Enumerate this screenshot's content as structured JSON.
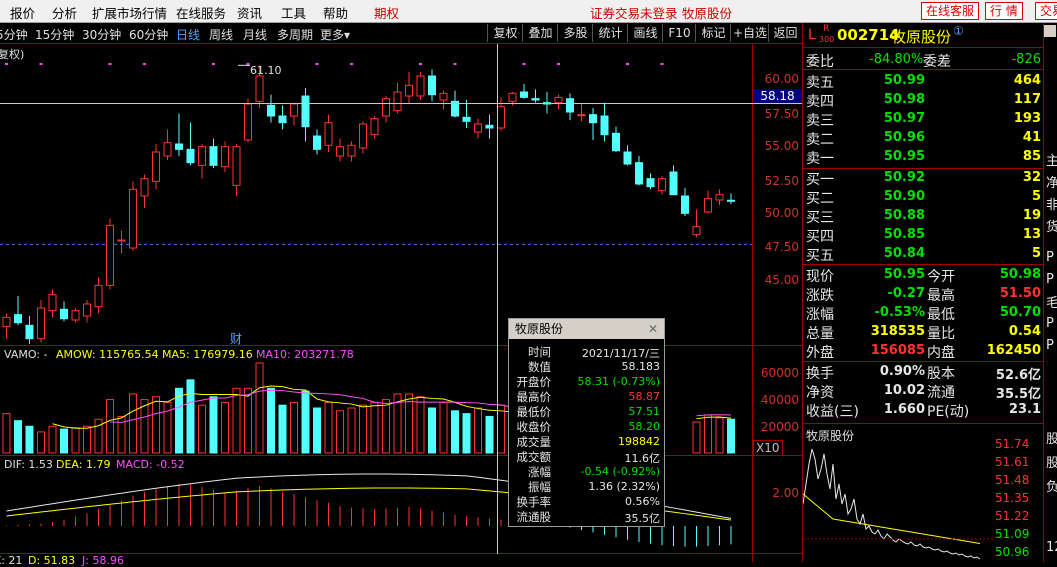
{
  "menu": {
    "items": [
      "报价",
      "分析",
      "扩展市场行情",
      "在线服务",
      "资讯",
      "工具",
      "帮助",
      "期权"
    ],
    "status": "证券交易未登录",
    "stock_name": "牧原股份",
    "btn_service": "在线客服",
    "btn_quote": "行 情",
    "btn_trade": "交易"
  },
  "toolbar": {
    "periods": [
      "5分钟",
      "15分钟",
      "30分钟",
      "60分钟",
      "日线",
      "周线",
      "月线",
      "多周期",
      "更多▾"
    ],
    "active_period": "日线",
    "buttons": [
      "复权",
      "叠加",
      "多股",
      "统计",
      "画线",
      "F10",
      "标记",
      "+自选",
      "返回"
    ]
  },
  "main_chart": {
    "mode_label": "复权)",
    "high_label": "61.10",
    "cross_price": "58.18",
    "event_marker": "财",
    "price_axis": [
      "60.00",
      "57.50",
      "55.00",
      "52.50",
      "50.00",
      "47.50",
      "45.00"
    ],
    "candles": [
      {
        "o": 41.5,
        "h": 42.5,
        "l": 40.6,
        "c": 42.2
      },
      {
        "o": 42.4,
        "h": 43.8,
        "l": 41.6,
        "c": 41.8
      },
      {
        "o": 41.6,
        "h": 42.3,
        "l": 40.2,
        "c": 40.6
      },
      {
        "o": 40.6,
        "h": 43.5,
        "l": 40.3,
        "c": 42.9
      },
      {
        "o": 42.7,
        "h": 44.3,
        "l": 42.2,
        "c": 43.9
      },
      {
        "o": 42.8,
        "h": 43.4,
        "l": 41.9,
        "c": 42.1
      },
      {
        "o": 42.0,
        "h": 42.9,
        "l": 41.8,
        "c": 42.7
      },
      {
        "o": 42.3,
        "h": 43.5,
        "l": 41.8,
        "c": 43.2
      },
      {
        "o": 43.0,
        "h": 45.2,
        "l": 42.5,
        "c": 44.6
      },
      {
        "o": 44.6,
        "h": 49.6,
        "l": 44.3,
        "c": 49.1
      },
      {
        "o": 48.0,
        "h": 48.7,
        "l": 47.0,
        "c": 48.0
      },
      {
        "o": 47.4,
        "h": 52.4,
        "l": 47.2,
        "c": 51.8
      },
      {
        "o": 51.3,
        "h": 52.9,
        "l": 50.4,
        "c": 52.6
      },
      {
        "o": 52.4,
        "h": 55.2,
        "l": 51.8,
        "c": 54.6
      },
      {
        "o": 54.3,
        "h": 56.3,
        "l": 54.0,
        "c": 55.3
      },
      {
        "o": 55.2,
        "h": 57.5,
        "l": 54.3,
        "c": 54.8
      },
      {
        "o": 54.8,
        "h": 56.8,
        "l": 53.6,
        "c": 53.8
      },
      {
        "o": 53.6,
        "h": 55.2,
        "l": 52.6,
        "c": 55.0
      },
      {
        "o": 55.0,
        "h": 55.6,
        "l": 53.4,
        "c": 53.6
      },
      {
        "o": 53.5,
        "h": 55.4,
        "l": 53.1,
        "c": 55.0
      },
      {
        "o": 52.1,
        "h": 55.2,
        "l": 51.3,
        "c": 55.0
      },
      {
        "o": 55.5,
        "h": 58.6,
        "l": 55.3,
        "c": 58.2
      },
      {
        "o": 58.4,
        "h": 61.1,
        "l": 57.9,
        "c": 60.3
      },
      {
        "o": 58.1,
        "h": 58.9,
        "l": 56.8,
        "c": 57.3
      },
      {
        "o": 57.3,
        "h": 58.1,
        "l": 56.3,
        "c": 56.8
      },
      {
        "o": 57.3,
        "h": 58.3,
        "l": 56.6,
        "c": 58.2
      },
      {
        "o": 58.8,
        "h": 59.4,
        "l": 55.4,
        "c": 56.5
      },
      {
        "o": 55.8,
        "h": 56.3,
        "l": 54.4,
        "c": 54.8
      },
      {
        "o": 55.1,
        "h": 57.4,
        "l": 54.6,
        "c": 56.8
      },
      {
        "o": 54.3,
        "h": 55.6,
        "l": 53.9,
        "c": 55.0
      },
      {
        "o": 54.3,
        "h": 55.4,
        "l": 53.9,
        "c": 55.1
      },
      {
        "o": 54.9,
        "h": 56.9,
        "l": 54.5,
        "c": 56.7
      },
      {
        "o": 55.9,
        "h": 57.3,
        "l": 55.6,
        "c": 57.1
      },
      {
        "o": 57.3,
        "h": 58.8,
        "l": 56.8,
        "c": 58.6
      },
      {
        "o": 57.7,
        "h": 59.8,
        "l": 57.5,
        "c": 59.1
      },
      {
        "o": 58.8,
        "h": 60.6,
        "l": 58.2,
        "c": 59.6
      },
      {
        "o": 58.8,
        "h": 60.6,
        "l": 58.5,
        "c": 60.3
      },
      {
        "o": 60.3,
        "h": 60.8,
        "l": 58.4,
        "c": 58.9
      },
      {
        "o": 58.5,
        "h": 59.2,
        "l": 57.8,
        "c": 59.0
      },
      {
        "o": 58.4,
        "h": 59.2,
        "l": 57.2,
        "c": 57.3
      },
      {
        "o": 57.2,
        "h": 58.5,
        "l": 56.4,
        "c": 56.9
      },
      {
        "o": 56.1,
        "h": 57.1,
        "l": 55.6,
        "c": 56.7
      },
      {
        "o": 56.6,
        "h": 57.4,
        "l": 55.6,
        "c": 56.4
      },
      {
        "o": 56.4,
        "h": 58.7,
        "l": 56.2,
        "c": 58.0
      },
      {
        "o": 58.4,
        "h": 59.1,
        "l": 58.1,
        "c": 59.0
      },
      {
        "o": 59.1,
        "h": 59.7,
        "l": 58.6,
        "c": 58.7
      },
      {
        "o": 58.6,
        "h": 59.3,
        "l": 58.3,
        "c": 58.5
      },
      {
        "o": 58.3,
        "h": 59.1,
        "l": 57.5,
        "c": 58.2
      },
      {
        "o": 58.3,
        "h": 58.9,
        "l": 57.8,
        "c": 58.7
      },
      {
        "o": 58.6,
        "h": 59.0,
        "l": 57.0,
        "c": 57.6
      },
      {
        "o": 57.4,
        "h": 58.2,
        "l": 56.9,
        "c": 57.4
      },
      {
        "o": 57.4,
        "h": 57.9,
        "l": 55.5,
        "c": 56.8
      },
      {
        "o": 57.3,
        "h": 58.3,
        "l": 55.4,
        "c": 55.9
      },
      {
        "o": 56.0,
        "h": 56.5,
        "l": 54.6,
        "c": 54.7
      },
      {
        "o": 54.6,
        "h": 55.1,
        "l": 53.6,
        "c": 53.7
      },
      {
        "o": 53.8,
        "h": 54.3,
        "l": 52.1,
        "c": 52.2
      },
      {
        "o": 52.6,
        "h": 53.0,
        "l": 51.8,
        "c": 52.0
      },
      {
        "o": 51.7,
        "h": 52.8,
        "l": 51.4,
        "c": 52.6
      },
      {
        "o": 53.1,
        "h": 53.6,
        "l": 51.4,
        "c": 51.4
      },
      {
        "o": 51.3,
        "h": 51.9,
        "l": 49.8,
        "c": 50.0
      },
      {
        "o": 48.4,
        "h": 50.3,
        "l": 48.2,
        "c": 49.0
      },
      {
        "o": 50.1,
        "h": 51.7,
        "l": 50.0,
        "c": 51.1
      },
      {
        "o": 51.0,
        "h": 51.8,
        "l": 50.6,
        "c": 51.4
      },
      {
        "o": 50.98,
        "h": 51.5,
        "l": 50.7,
        "c": 50.95
      }
    ]
  },
  "vol_panel": {
    "label": "VAMO: -",
    "amow_label": "AMOW: 115765.54",
    "ma5_label": "MA5: 176979.16",
    "ma10_label": "MA10: 203271.78",
    "axis": [
      "60000",
      "40000",
      "20000"
    ],
    "x10": "X10",
    "bars": [
      140000,
      115000,
      95000,
      75000,
      95000,
      85000,
      90000,
      95000,
      120000,
      190000,
      130000,
      210000,
      190000,
      200000,
      180000,
      230000,
      260000,
      170000,
      200000,
      180000,
      230000,
      230000,
      320000,
      230000,
      170000,
      180000,
      220000,
      160000,
      180000,
      150000,
      160000,
      170000,
      180000,
      190000,
      210000,
      210000,
      200000,
      160000,
      180000,
      150000,
      140000,
      160000,
      130000,
      170000,
      130000,
      120000,
      130000,
      110000,
      105000,
      100000,
      100000,
      105000,
      120000,
      130000,
      180000,
      180000,
      110000,
      120000,
      140000,
      130000,
      110000,
      135000,
      125000,
      120000
    ]
  },
  "macd_panel": {
    "dif_label": "DIF: 1.53",
    "dea_label": "DEA: 1.79",
    "macd_label": "MACD: -0.52",
    "axis": [
      "2.00"
    ]
  },
  "bottom_label": {
    "k": "K:  21",
    "d": "D: 51.83",
    "j": "J: 58.96"
  },
  "popup": {
    "title": "牧原股份",
    "rows": [
      {
        "label": "时间",
        "value": "2021/11/17/三",
        "color": "w"
      },
      {
        "label": "数值",
        "value": "58.183",
        "color": "w"
      },
      {
        "label": "开盘价",
        "value": "58.31 (-0.73%)",
        "color": "g"
      },
      {
        "label": "最高价",
        "value": "58.87",
        "color": "r"
      },
      {
        "label": "最低价",
        "value": "57.51",
        "color": "g"
      },
      {
        "label": "收盘价",
        "value": "58.20",
        "color": "g"
      },
      {
        "label": "成交量",
        "value": "198842",
        "color": "y"
      },
      {
        "label": "成交额",
        "value": "11.6亿",
        "color": "w"
      },
      {
        "label": "涨幅",
        "value": "-0.54 (-0.92%)",
        "color": "g"
      },
      {
        "label": "振幅",
        "value": "1.36 (2.32%)",
        "color": "w"
      },
      {
        "label": "换手率",
        "value": "0.56%",
        "color": "w"
      },
      {
        "label": "流通股",
        "value": "35.5亿",
        "color": "w"
      }
    ]
  },
  "quote": {
    "market_flag": "L",
    "rank_flag": "R",
    "rank_num": "300",
    "code": "002714",
    "name": "牧原股份",
    "info_icon": "①",
    "weibi": {
      "label": "委比",
      "value": "-84.80%",
      "label2": "委差",
      "value2": "-826"
    },
    "sells": [
      {
        "label": "卖五",
        "price": "50.99",
        "vol": "464"
      },
      {
        "label": "卖四",
        "price": "50.98",
        "vol": "117"
      },
      {
        "label": "卖三",
        "price": "50.97",
        "vol": "193"
      },
      {
        "label": "卖二",
        "price": "50.96",
        "vol": "41"
      },
      {
        "label": "卖一",
        "price": "50.95",
        "vol": "85"
      }
    ],
    "buys": [
      {
        "label": "买一",
        "price": "50.92",
        "vol": "32"
      },
      {
        "label": "买二",
        "price": "50.90",
        "vol": "5"
      },
      {
        "label": "买三",
        "price": "50.88",
        "vol": "19"
      },
      {
        "label": "买四",
        "price": "50.85",
        "vol": "13"
      },
      {
        "label": "买五",
        "price": "50.84",
        "vol": "5"
      }
    ],
    "stats": [
      {
        "l1": "现价",
        "v1": "50.95",
        "c1": "g",
        "l2": "今开",
        "v2": "50.98",
        "c2": "g"
      },
      {
        "l1": "涨跌",
        "v1": "-0.27",
        "c1": "g",
        "l2": "最高",
        "v2": "51.50",
        "c2": "r"
      },
      {
        "l1": "涨幅",
        "v1": "-0.53%",
        "c1": "g",
        "l2": "最低",
        "v2": "50.70",
        "c2": "g"
      },
      {
        "l1": "总量",
        "v1": "318535",
        "c1": "y",
        "l2": "量比",
        "v2": "0.54",
        "c2": "y"
      },
      {
        "l1": "外盘",
        "v1": "156085",
        "c1": "r",
        "l2": "内盘",
        "v2": "162450",
        "c2": "y"
      }
    ],
    "stats2": [
      {
        "l1": "换手",
        "v1": "0.90%",
        "c1": "w",
        "l2": "股本",
        "v2": "52.6亿",
        "c2": "w"
      },
      {
        "l1": "净资",
        "v1": "10.02",
        "c1": "w",
        "l2": "流通",
        "v2": "35.5亿",
        "c2": "w"
      },
      {
        "l1": "收益(三)",
        "v1": "1.660",
        "c1": "w",
        "l2": "PE(动)",
        "v2": "23.1",
        "c2": "w"
      }
    ]
  },
  "mini_chart": {
    "title": "牧原股份",
    "axis": [
      "51.74",
      "51.61",
      "51.48",
      "51.35",
      "51.22",
      "51.09",
      "50.96"
    ]
  },
  "edge_chars": [
    "主",
    "净",
    "非",
    "货",
    "P",
    "P",
    "毛",
    "P",
    "P",
    "股",
    "股",
    "负",
    "12"
  ],
  "colors": {
    "up": "#ff3232",
    "down": "#54ffff",
    "ma5": "#ffff00",
    "ma10": "#ff50ff",
    "axis": "#a00000",
    "accent": "#d00000"
  }
}
